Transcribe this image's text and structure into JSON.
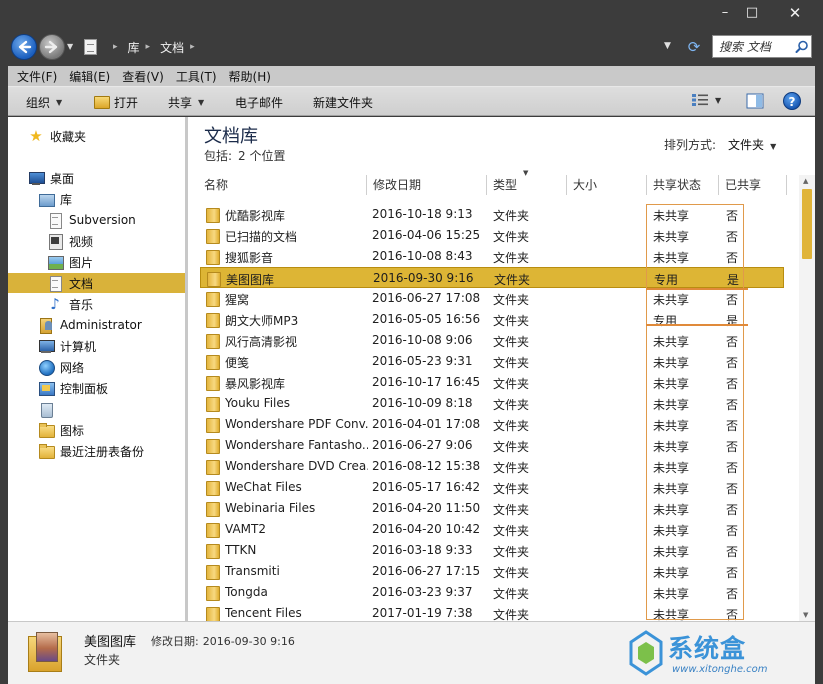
{
  "window": {
    "min": "–",
    "max": "□",
    "close": "✕"
  },
  "address": {
    "crumbs": [
      "库",
      "文档"
    ],
    "search_placeholder": "搜索 文档"
  },
  "menu": [
    "文件(F)",
    "编辑(E)",
    "查看(V)",
    "工具(T)",
    "帮助(H)"
  ],
  "toolbar": {
    "organize": "组织",
    "open": "打开",
    "share": "共享",
    "email": "电子邮件",
    "new_folder": "新建文件夹"
  },
  "nav": {
    "favorites": "收藏夹",
    "desktop": "桌面",
    "libraries": "库",
    "subversion": "Subversion",
    "videos": "视频",
    "pictures": "图片",
    "documents": "文档",
    "music": "音乐",
    "administrator": "Administrator",
    "computer": "计算机",
    "network": "网络",
    "control_panel": "控制面板",
    "icons": "图标",
    "registry_backup": "最近注册表备份"
  },
  "library": {
    "title": "文档库",
    "includes_label": "包括:",
    "includes_value": "2 个位置",
    "arrange_label": "排列方式:",
    "arrange_value": "文件夹"
  },
  "columns": {
    "name": "名称",
    "date": "修改日期",
    "type": "类型",
    "size": "大小",
    "share_status": "共享状态",
    "shared": "已共享"
  },
  "files": [
    {
      "name": "优酷影视库",
      "date": "2016-10-18 9:13",
      "type": "文件夹",
      "share": "未共享",
      "shared": "否"
    },
    {
      "name": "已扫描的文档",
      "date": "2016-04-06 15:25",
      "type": "文件夹",
      "share": "未共享",
      "shared": "否"
    },
    {
      "name": "搜狐影音",
      "date": "2016-10-08 8:43",
      "type": "文件夹",
      "share": "未共享",
      "shared": "否"
    },
    {
      "name": "美图图库",
      "date": "2016-09-30 9:16",
      "type": "文件夹",
      "share": "专用",
      "shared": "是"
    },
    {
      "name": "猩窝",
      "date": "2016-06-27 17:08",
      "type": "文件夹",
      "share": "未共享",
      "shared": "否"
    },
    {
      "name": "朗文大师MP3",
      "date": "2016-05-05 16:56",
      "type": "文件夹",
      "share": "专用",
      "shared": "是"
    },
    {
      "name": "风行高清影视",
      "date": "2016-10-08 9:06",
      "type": "文件夹",
      "share": "未共享",
      "shared": "否"
    },
    {
      "name": "便笺",
      "date": "2016-05-23 9:31",
      "type": "文件夹",
      "share": "未共享",
      "shared": "否"
    },
    {
      "name": "暴风影视库",
      "date": "2016-10-17 16:45",
      "type": "文件夹",
      "share": "未共享",
      "shared": "否"
    },
    {
      "name": "Youku Files",
      "date": "2016-10-09 8:18",
      "type": "文件夹",
      "share": "未共享",
      "shared": "否"
    },
    {
      "name": "Wondershare PDF Conv...",
      "date": "2016-04-01 17:08",
      "type": "文件夹",
      "share": "未共享",
      "shared": "否"
    },
    {
      "name": "Wondershare Fantasho...",
      "date": "2016-06-27 9:06",
      "type": "文件夹",
      "share": "未共享",
      "shared": "否"
    },
    {
      "name": "Wondershare DVD Crea...",
      "date": "2016-08-12 15:38",
      "type": "文件夹",
      "share": "未共享",
      "shared": "否"
    },
    {
      "name": "WeChat Files",
      "date": "2016-05-17 16:42",
      "type": "文件夹",
      "share": "未共享",
      "shared": "否"
    },
    {
      "name": "Webinaria Files",
      "date": "2016-04-20 11:50",
      "type": "文件夹",
      "share": "未共享",
      "shared": "否"
    },
    {
      "name": "VAMT2",
      "date": "2016-04-20 10:42",
      "type": "文件夹",
      "share": "未共享",
      "shared": "否"
    },
    {
      "name": "TTKN",
      "date": "2016-03-18 9:33",
      "type": "文件夹",
      "share": "未共享",
      "shared": "否"
    },
    {
      "name": "Transmiti",
      "date": "2016-06-27 17:15",
      "type": "文件夹",
      "share": "未共享",
      "shared": "否"
    },
    {
      "name": "Tongda",
      "date": "2016-03-23 9:37",
      "type": "文件夹",
      "share": "未共享",
      "shared": "否"
    },
    {
      "name": "Tencent Files",
      "date": "2017-01-19 7:38",
      "type": "文件夹",
      "share": "未共享",
      "shared": "否"
    }
  ],
  "selected_index": 3,
  "details": {
    "name": "美图图库",
    "date_label": "修改日期:",
    "date_value": "2016-09-30 9:16",
    "type": "文件夹"
  },
  "watermark": {
    "text": "系统盒",
    "url": "www.xitonghe.com"
  },
  "colors": {
    "selection": "#ddb535",
    "highlight": "#e09a4b",
    "frame": "#3c3c3c"
  }
}
